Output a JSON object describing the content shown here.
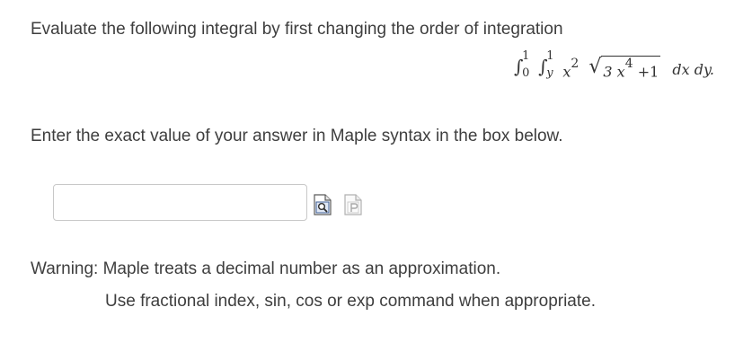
{
  "question": {
    "prompt": "Evaluate the following integral by first changing the order of integration",
    "integral": {
      "outer_upper": "1",
      "outer_lower": "0",
      "inner_upper": "1",
      "inner_lower": "y",
      "integrand_x": "x",
      "integrand_x_power": "2",
      "radicand_coef": "3 x",
      "radicand_power": "4",
      "radicand_const": "+1",
      "differentials": "dx dy."
    },
    "instruction": "Enter the exact value of your answer in Maple syntax in the box below."
  },
  "answer": {
    "value": "",
    "placeholder": ""
  },
  "tools": {
    "preview_icon": "preview-magnifier-icon",
    "plot_icon": "plot-p-icon"
  },
  "notes": {
    "warning": "Warning: Maple treats a decimal number as an approximation.",
    "hint": "Use fractional index, sin, cos or exp command when appropriate."
  }
}
